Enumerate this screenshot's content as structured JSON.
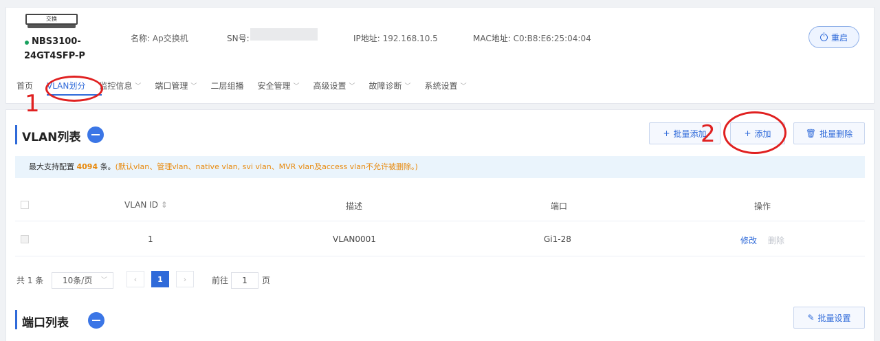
{
  "device": {
    "image_label": "交换",
    "model_line1": "NBS3100-",
    "model_line2": "24GT4SFP-P",
    "status_color": "#19a15f",
    "name_label": "名称:",
    "name_value": "Ap交换机",
    "sn_label": "SN号:",
    "ip_label": "IP地址:",
    "ip_value": "192.168.10.5",
    "mac_label": "MAC地址:",
    "mac_value": "C0:B8:E6:25:04:04",
    "reboot_label": "重启"
  },
  "nav": {
    "items": [
      {
        "label": "首页",
        "chevron": false
      },
      {
        "label": "VLAN划分",
        "chevron": false,
        "active": true
      },
      {
        "label": "监控信息",
        "chevron": true
      },
      {
        "label": "端口管理",
        "chevron": true
      },
      {
        "label": "二层组播",
        "chevron": false
      },
      {
        "label": "安全管理",
        "chevron": true
      },
      {
        "label": "高级设置",
        "chevron": true
      },
      {
        "label": "故障诊断",
        "chevron": true
      },
      {
        "label": "系统设置",
        "chevron": true
      }
    ]
  },
  "annotations": {
    "num1": "1",
    "num2": "2"
  },
  "vlan_section": {
    "title": "VLAN列表",
    "batch_add": "批量添加",
    "add": "添加",
    "batch_delete": "批量删除",
    "notice_prefix": "最大支持配置",
    "notice_count": "4094",
    "notice_mid": "条。",
    "notice_warn": "(默认vlan、管理vlan、native vlan, svi vlan、MVR vlan及access vlan不允许被删除。)",
    "columns": {
      "vlan_id": "VLAN ID",
      "desc": "描述",
      "port": "端口",
      "ops": "操作"
    },
    "rows": [
      {
        "vlan_id": "1",
        "desc": "VLAN0001",
        "port": "Gi1-28",
        "edit": "修改",
        "delete": "删除"
      }
    ]
  },
  "pager": {
    "total": "共 1 条",
    "page_size": "10条/页",
    "current_page": "1",
    "goto_label": "前往",
    "goto_value": "1",
    "page_suffix": "页"
  },
  "port_section": {
    "title": "端口列表",
    "batch_set": "批量设置"
  },
  "colors": {
    "accent": "#2f6ad9",
    "warning": "#e8890c",
    "annotation": "#e02020"
  }
}
